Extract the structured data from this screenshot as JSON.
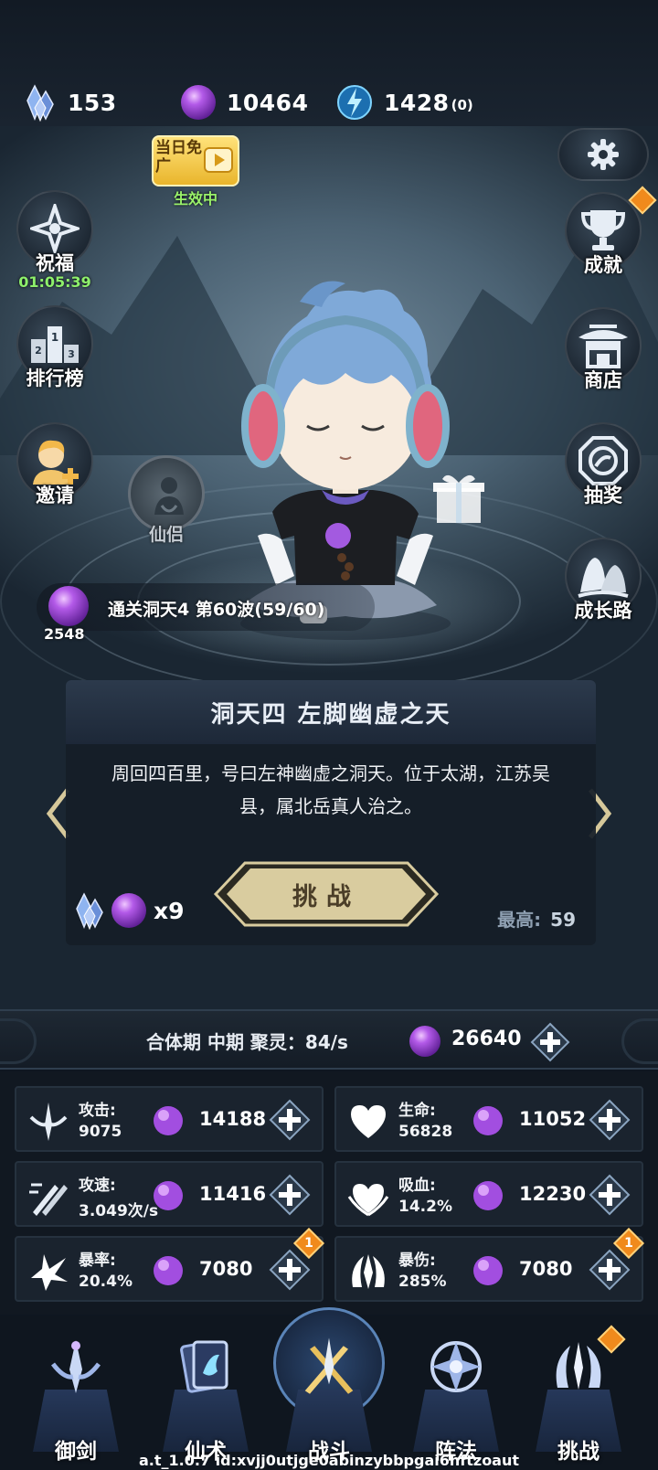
{
  "resources": {
    "crystal": {
      "icon": "crystal-cluster-icon",
      "value": "153"
    },
    "orb": {
      "icon": "purple-orb-icon",
      "value": "10464"
    },
    "energy": {
      "icon": "blue-energy-icon",
      "value": "1428",
      "sub": "(0)"
    }
  },
  "ad_badge": {
    "title": "当日免广",
    "status": "生效中"
  },
  "left_buttons": [
    {
      "label": "祝福",
      "icon": "blessing-star-icon",
      "timer": "01:05:39"
    },
    {
      "label": "排行榜",
      "icon": "podium-icon"
    },
    {
      "label": "邀请",
      "icon": "invite-friend-icon"
    }
  ],
  "right_buttons": [
    {
      "label": "",
      "icon": "gear-icon"
    },
    {
      "label": "成就",
      "icon": "trophy-icon"
    },
    {
      "label": "商店",
      "icon": "shop-pavilion-icon"
    },
    {
      "label": "抽奖",
      "icon": "lottery-swirl-icon"
    },
    {
      "label": "成长路",
      "icon": "growth-mountain-icon"
    }
  ],
  "companion": {
    "label": "仙侣"
  },
  "progress": {
    "orb_count": "2548",
    "text": "通关洞天4 第60波(59/60)"
  },
  "stage": {
    "title": "洞天四 左脚幽虚之天",
    "description": "周回四百里，号曰左神幽虚之洞天。位于太湖，江苏吴县，属北岳真人治之。",
    "challenge_label": "挑战",
    "cost": "x9",
    "best_label": "最高:",
    "best_value": "59"
  },
  "realm": {
    "text": "合体期 中期 聚灵：84/s",
    "orbs": "26640"
  },
  "stats": [
    {
      "name": "攻击:",
      "value": "9075",
      "cost": "14188",
      "icon": "sword-attack-icon",
      "badge": ""
    },
    {
      "name": "生命:",
      "value": "56828",
      "cost": "11052",
      "icon": "heart-icon",
      "badge": ""
    },
    {
      "name": "攻速:",
      "value": "3.049次/s",
      "cost": "11416",
      "icon": "attack-speed-icon",
      "badge": ""
    },
    {
      "name": "吸血:",
      "value": "14.2%",
      "cost": "12230",
      "icon": "lifesteal-heart-icon",
      "badge": ""
    },
    {
      "name": "暴率:",
      "value": "20.4%",
      "cost": "7080",
      "icon": "crit-rate-icon",
      "badge": "1"
    },
    {
      "name": "暴伤:",
      "value": "285%",
      "cost": "7080",
      "icon": "crit-damage-icon",
      "badge": "1"
    }
  ],
  "nav": [
    {
      "label": "御剑",
      "icon": "flying-sword-icon"
    },
    {
      "label": "仙术",
      "icon": "spell-card-icon"
    },
    {
      "label": "战斗",
      "icon": "crossed-swords-icon"
    },
    {
      "label": "阵法",
      "icon": "formation-icon"
    },
    {
      "label": "挑战",
      "icon": "challenge-blade-icon"
    }
  ],
  "version": "a.t_1.0.7 id:xvjj0utjge0abinzybbpgai6hftzoaut",
  "colors": {
    "orb": "#9b47d6",
    "accent": "#f08a1c",
    "timer": "#8ef06b",
    "button_gold": "#d9cc9f"
  }
}
